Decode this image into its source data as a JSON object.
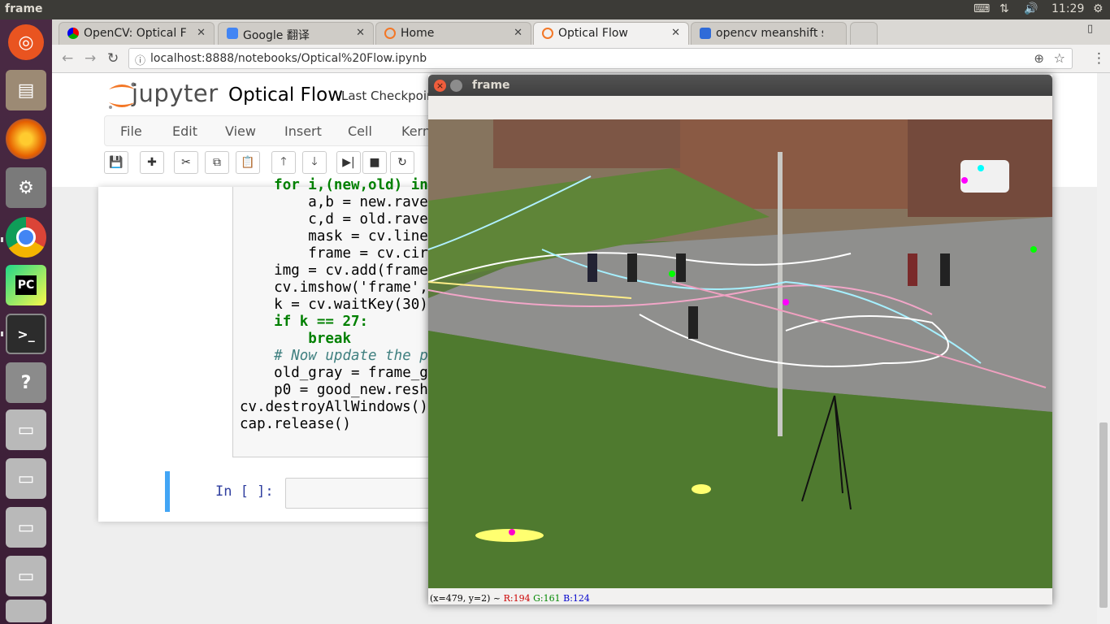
{
  "topbar": {
    "title": "frame",
    "time": "11:29"
  },
  "browser": {
    "tabs": [
      {
        "label": "OpenCV: Optical Flow",
        "active": false
      },
      {
        "label": "Google 翻译",
        "active": false
      },
      {
        "label": "Home",
        "active": false
      },
      {
        "label": "Optical Flow",
        "active": true
      },
      {
        "label": "opencv meanshift s",
        "active": false
      }
    ],
    "tab_close": "✕",
    "url": "localhost:8888/notebooks/Optical%20Flow.ipynb"
  },
  "jupyter": {
    "logo_text": "jupyter",
    "notebook_title": "Optical Flow",
    "checkpoint": "Last Checkpoint",
    "menu": [
      "File",
      "Edit",
      "View",
      "Insert",
      "Cell",
      "Kernel"
    ],
    "code_lines": [
      {
        "indent": "    ",
        "text": "for i,(new,old) in"
      },
      {
        "indent": "        ",
        "text": "a,b = new.rave"
      },
      {
        "indent": "        ",
        "text": "c,d = old.rave"
      },
      {
        "indent": "        ",
        "text": "mask = cv.line"
      },
      {
        "indent": "        ",
        "text": "frame = cv.cir"
      },
      {
        "indent": "    ",
        "text": "img = cv.add(frame"
      },
      {
        "indent": "    ",
        "text": "cv.imshow('frame',"
      },
      {
        "indent": "    ",
        "text": "k = cv.waitKey(30)"
      },
      {
        "indent": "    ",
        "text": "if k == 27:"
      },
      {
        "indent": "        ",
        "text": "break"
      },
      {
        "indent": "    ",
        "text": "# Now update the p"
      },
      {
        "indent": "    ",
        "text": "old_gray = frame_g"
      },
      {
        "indent": "    ",
        "text": "p0 = good_new.resh"
      },
      {
        "indent": "",
        "text": "cv.destroyAllWindows()"
      },
      {
        "indent": "",
        "text": "cap.release()"
      }
    ],
    "empty_prompt": "In [ ]:"
  },
  "cv_window": {
    "title": "frame",
    "status": {
      "coords": "(x=479, y=2) ~",
      "r": "R:194",
      "g": "G:161",
      "b": "B:124"
    }
  },
  "colors": {
    "accent": "#42a5f5",
    "chrome_bg": "#dad8d4",
    "ubuntu_orange": "#e95420",
    "cv_close": "#ef5d3c"
  }
}
